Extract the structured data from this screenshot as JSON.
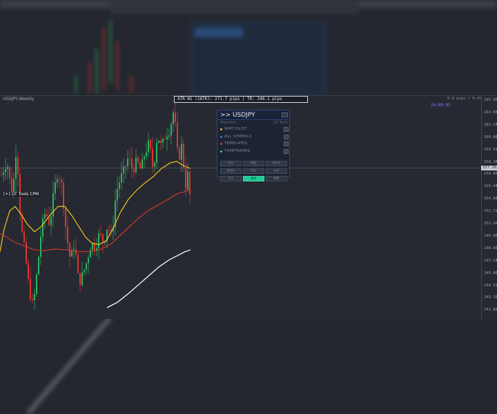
{
  "chart": {
    "title": "USDJPY,Weekly",
    "atr_text": "ATR W1 (1ATR): 271.7 pips   |   TR: 246.1 pips",
    "top_right": "0.0 pips / 0.0%",
    "timer": "24:00:02",
    "indicator_label": "[+] GT Tools CPM",
    "current_price": "157.282",
    "price_ticks": [
      "165.000",
      "163.680",
      "162.240",
      "160.880",
      "159.520",
      "158.160",
      "156.800",
      "155.440",
      "154.080",
      "152.720",
      "151.360",
      "149.960",
      "148.600",
      "147.240",
      "145.880",
      "144.520",
      "143.160",
      "141.800"
    ]
  },
  "panel": {
    "title": ">> USDJPY",
    "close_label": "–",
    "sub_left": "Watchlist",
    "sub_right": "GT Tools",
    "rows": [
      {
        "label": "WATCHLIST",
        "dot": "#e8b12a"
      },
      {
        "label": "ALL SYMBOLS",
        "dot": "#3d7fe0"
      },
      {
        "label": "TEMPLATES",
        "dot": "#c0407a"
      },
      {
        "label": "TIMEFRAMES",
        "dot": "#4fc07a"
      }
    ],
    "timeframes": [
      "M1",
      "M5",
      "M15",
      "M30",
      "H1",
      "H4",
      "D1",
      "W1",
      "MN"
    ],
    "active_timeframe": "W1"
  },
  "colors": {
    "bull": "#2fb360",
    "bear": "#e0342f",
    "ma_fast": "#f3c51c",
    "ma_mid": "#dd3a2a",
    "ma_slow": "#f2f2f2"
  }
}
